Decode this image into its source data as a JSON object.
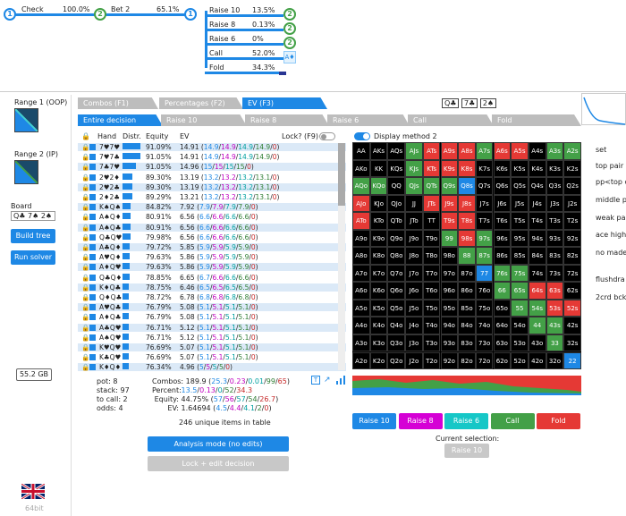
{
  "tree": {
    "check_label": "Check",
    "check_pct": "100.0%",
    "bet_label": "Bet 2",
    "bet_pct": "65.1%",
    "node1": "1",
    "node2": "2",
    "node3": "1",
    "actions": [
      {
        "label": "Raise 10",
        "pct": "13.5%",
        "node": "2"
      },
      {
        "label": "Raise 8",
        "pct": "0.13%",
        "node": "2"
      },
      {
        "label": "Raise 6",
        "pct": "0%",
        "node": "2"
      },
      {
        "label": "Call",
        "pct": "52.0%",
        "node": "A♦"
      },
      {
        "label": "Fold",
        "pct": "34.3%",
        "node": ""
      }
    ]
  },
  "left": {
    "range1_label": "Range 1 (OOP)",
    "range2_label": "Range 2 (IP)",
    "board_label": "Board",
    "board_value": "Q♣ 7♠ 2♠",
    "build_tree": "Build tree",
    "run_solver": "Run solver",
    "memory": "55.2 GB",
    "bits": "64bit"
  },
  "tabs": {
    "combos": "Combos (F1)",
    "percentages": "Percentages (F2)",
    "ev": "EV (F3)",
    "board_cards": [
      "Q♣",
      "7♣",
      "2♠"
    ],
    "sub": [
      "Entire decision",
      "Raise 10",
      "Raise 8",
      "Raise 6",
      "Call",
      "Fold"
    ]
  },
  "table": {
    "headers": {
      "hand": "Hand",
      "distr": "Distr.",
      "equity": "Equity",
      "ev": "EV",
      "lock": "Lock? (F9)"
    },
    "rows": [
      {
        "hand": "7♥7♥",
        "eq": "91.09%",
        "ev": "14.91",
        "parts": [
          "14.9",
          "14.9",
          "14.9",
          "14.9",
          "0"
        ],
        "d": 0.9,
        "alt": true,
        "c1": "#c62828",
        "c2": "#c62828"
      },
      {
        "hand": "7♥7♣",
        "eq": "91.05%",
        "ev": "14.91",
        "parts": [
          "14.9",
          "14.9",
          "14.9",
          "14.9",
          "0"
        ],
        "d": 0.9,
        "alt": false,
        "c1": "#c62828",
        "c2": "#2e7d32"
      },
      {
        "hand": "7♣7♥",
        "eq": "91.05%",
        "ev": "14.96",
        "parts": [
          "15",
          "15",
          "15",
          "15",
          "0"
        ],
        "d": 0.7,
        "alt": true,
        "c1": "#2e7d32",
        "c2": "#c62828"
      },
      {
        "hand": "2♥2♦",
        "eq": "89.30%",
        "ev": "13.19",
        "parts": [
          "13.2",
          "13.2",
          "13.2",
          "13.1",
          "0"
        ],
        "d": 0.5,
        "alt": false,
        "c1": "#c62828",
        "c2": "#1e88e5"
      },
      {
        "hand": "2♥2♣",
        "eq": "89.30%",
        "ev": "13.19",
        "parts": [
          "13.2",
          "13.2",
          "13.2",
          "13.1",
          "0"
        ],
        "d": 0.5,
        "alt": true,
        "c1": "#c62828",
        "c2": "#2e7d32"
      },
      {
        "hand": "2♦2♣",
        "eq": "89.29%",
        "ev": "13.21",
        "parts": [
          "13.2",
          "13.2",
          "13.2",
          "13.1",
          "0"
        ],
        "d": 0.5,
        "alt": false,
        "c1": "#1e88e5",
        "c2": "#2e7d32"
      },
      {
        "hand": "K♠Q♠",
        "eq": "84.82%",
        "ev": "7.92",
        "parts": [
          "7.9",
          "7.9",
          "7.9",
          "7.9",
          "0"
        ],
        "d": 0.4,
        "alt": true,
        "c1": "#222",
        "c2": "#222"
      },
      {
        "hand": "A♠Q♦",
        "eq": "80.91%",
        "ev": "6.56",
        "parts": [
          "6.6",
          "6.6",
          "6.6",
          "6.6",
          "0"
        ],
        "d": 0.4,
        "alt": false,
        "c1": "#222",
        "c2": "#1e88e5"
      },
      {
        "hand": "A♠Q♣",
        "eq": "80.91%",
        "ev": "6.56",
        "parts": [
          "6.6",
          "6.6",
          "6.6",
          "6.6",
          "0"
        ],
        "d": 0.4,
        "alt": true,
        "c1": "#222",
        "c2": "#2e7d32"
      },
      {
        "hand": "Q♣Q♥",
        "eq": "79.98%",
        "ev": "6.56",
        "parts": [
          "6.6",
          "6.6",
          "6.6",
          "6.6",
          "0"
        ],
        "d": 0.4,
        "alt": false,
        "c1": "#2e7d32",
        "c2": "#c62828"
      },
      {
        "hand": "A♣Q♦",
        "eq": "79.72%",
        "ev": "5.85",
        "parts": [
          "5.9",
          "5.9",
          "5.9",
          "5.9",
          "0"
        ],
        "d": 0.35,
        "alt": true,
        "c1": "#2e7d32",
        "c2": "#1e88e5"
      },
      {
        "hand": "A♥Q♦",
        "eq": "79.63%",
        "ev": "5.86",
        "parts": [
          "5.9",
          "5.9",
          "5.9",
          "5.9",
          "0"
        ],
        "d": 0.35,
        "alt": false,
        "c1": "#c62828",
        "c2": "#1e88e5"
      },
      {
        "hand": "A♦Q♥",
        "eq": "79.63%",
        "ev": "5.86",
        "parts": [
          "5.9",
          "5.9",
          "5.9",
          "5.9",
          "0"
        ],
        "d": 0.35,
        "alt": true,
        "c1": "#1e88e5",
        "c2": "#c62828"
      },
      {
        "hand": "Q♣Q♦",
        "eq": "78.85%",
        "ev": "6.65",
        "parts": [
          "6.7",
          "6.6",
          "6.6",
          "6.6",
          "0"
        ],
        "d": 0.35,
        "alt": false,
        "c1": "#2e7d32",
        "c2": "#1e88e5"
      },
      {
        "hand": "K♦Q♣",
        "eq": "78.75%",
        "ev": "6.46",
        "parts": [
          "6.5",
          "6.5",
          "6.5",
          "6.5",
          "0"
        ],
        "d": 0.3,
        "alt": true,
        "c1": "#1e88e5",
        "c2": "#2e7d32"
      },
      {
        "hand": "Q♦Q♣",
        "eq": "78.72%",
        "ev": "6.78",
        "parts": [
          "6.8",
          "6.8",
          "6.8",
          "6.8",
          "0"
        ],
        "d": 0.3,
        "alt": false,
        "c1": "#1e88e5",
        "c2": "#2e7d32"
      },
      {
        "hand": "A♥Q♣",
        "eq": "76.79%",
        "ev": "5.08",
        "parts": [
          "5.1",
          "5.1",
          "5.1",
          "5.1",
          "0"
        ],
        "d": 0.3,
        "alt": true,
        "c1": "#c62828",
        "c2": "#2e7d32"
      },
      {
        "hand": "A♦Q♣",
        "eq": "76.79%",
        "ev": "5.08",
        "parts": [
          "5.1",
          "5.1",
          "5.1",
          "5.1",
          "0"
        ],
        "d": 0.3,
        "alt": false,
        "c1": "#1e88e5",
        "c2": "#2e7d32"
      },
      {
        "hand": "A♣Q♥",
        "eq": "76.71%",
        "ev": "5.12",
        "parts": [
          "5.1",
          "5.1",
          "5.1",
          "5.1",
          "0"
        ],
        "d": 0.3,
        "alt": true,
        "c1": "#2e7d32",
        "c2": "#c62828"
      },
      {
        "hand": "A♠Q♥",
        "eq": "76.71%",
        "ev": "5.12",
        "parts": [
          "5.1",
          "5.1",
          "5.1",
          "5.1",
          "0"
        ],
        "d": 0.3,
        "alt": false,
        "c1": "#222",
        "c2": "#c62828"
      },
      {
        "hand": "K♥Q♥",
        "eq": "76.69%",
        "ev": "5.07",
        "parts": [
          "5.1",
          "5.1",
          "5.1",
          "5.1",
          "0"
        ],
        "d": 0.3,
        "alt": true,
        "c1": "#c62828",
        "c2": "#c62828"
      },
      {
        "hand": "K♣Q♥",
        "eq": "76.69%",
        "ev": "5.07",
        "parts": [
          "5.1",
          "5.1",
          "5.1",
          "5.1",
          "0"
        ],
        "d": 0.3,
        "alt": false,
        "c1": "#2e7d32",
        "c2": "#c62828"
      },
      {
        "hand": "K♦Q♦",
        "eq": "76.34%",
        "ev": "4.96",
        "parts": [
          "5",
          "5",
          "5",
          "5",
          "0"
        ],
        "d": 0.3,
        "alt": true,
        "c1": "#1e88e5",
        "c2": "#1e88e5"
      }
    ]
  },
  "summary": {
    "pot": "pot: 8",
    "stack": "stack: 97",
    "tocall": "to call: 2",
    "odds": "odds: 4",
    "combos_label": "Combos:",
    "combos_val": "189.9",
    "combos_parts": [
      "25.3",
      "0.23",
      "0.01",
      "99",
      "65"
    ],
    "percent_label": "Percent:",
    "percent_parts": [
      "13.5",
      "0.13",
      "0",
      "52",
      "34.3"
    ],
    "equity_label": "Equity:",
    "equity_val": "44.75%",
    "equity_parts": [
      "57",
      "56",
      "57",
      "54",
      "26.7"
    ],
    "ev_label": "EV:",
    "ev_val": "1.64694",
    "ev_parts": [
      "4.5",
      "4.4",
      "4.1",
      "2",
      "0"
    ],
    "unique": "246 unique items in table"
  },
  "buttons": {
    "analysis": "Analysis mode (no edits)",
    "lock": "Lock + edit decision",
    "display": "Display method 2",
    "current_sel": "Current selection:",
    "current_val": "Raise 10"
  },
  "legend": [
    {
      "label": "Raise 10",
      "color": "#1e88e5"
    },
    {
      "label": "Raise 8",
      "color": "#d500d5"
    },
    {
      "label": "Raise 6",
      "color": "#16c7c7"
    },
    {
      "label": "Call",
      "color": "#43a047"
    },
    {
      "label": "Fold",
      "color": "#e53935"
    }
  ],
  "right_list": [
    "set",
    "top pair",
    "pp<top c",
    "middle p",
    "weak pai",
    "ace high",
    "no made",
    "flushdra",
    "2crd bck"
  ],
  "grid": [
    [
      "AA",
      "AKs",
      "AQs",
      "AJs",
      "ATs",
      "A9s",
      "A8s",
      "A7s",
      "A6s",
      "A5s",
      "A4s",
      "A3s",
      "A2s"
    ],
    [
      "AKo",
      "KK",
      "KQs",
      "KJs",
      "KTs",
      "K9s",
      "K8s",
      "K7s",
      "K6s",
      "K5s",
      "K4s",
      "K3s",
      "K2s"
    ],
    [
      "AQo",
      "KQo",
      "QQ",
      "QJs",
      "QTs",
      "Q9s",
      "Q8s",
      "Q7s",
      "Q6s",
      "Q5s",
      "Q4s",
      "Q3s",
      "Q2s"
    ],
    [
      "AJo",
      "KJo",
      "QJo",
      "JJ",
      "JTs",
      "J9s",
      "J8s",
      "J7s",
      "J6s",
      "J5s",
      "J4s",
      "J3s",
      "J2s"
    ],
    [
      "ATo",
      "KTo",
      "QTo",
      "JTo",
      "TT",
      "T9s",
      "T8s",
      "T7s",
      "T6s",
      "T5s",
      "T4s",
      "T3s",
      "T2s"
    ],
    [
      "A9o",
      "K9o",
      "Q9o",
      "J9o",
      "T9o",
      "99",
      "98s",
      "97s",
      "96s",
      "95s",
      "94s",
      "93s",
      "92s"
    ],
    [
      "A8o",
      "K8o",
      "Q8o",
      "J8o",
      "T8o",
      "98o",
      "88",
      "87s",
      "86s",
      "85s",
      "84s",
      "83s",
      "82s"
    ],
    [
      "A7o",
      "K7o",
      "Q7o",
      "J7o",
      "T7o",
      "97o",
      "87o",
      "77",
      "76s",
      "75s",
      "74s",
      "73s",
      "72s"
    ],
    [
      "A6o",
      "K6o",
      "Q6o",
      "J6o",
      "T6o",
      "96o",
      "86o",
      "76o",
      "66",
      "65s",
      "64s",
      "63s",
      "62s"
    ],
    [
      "A5o",
      "K5o",
      "Q5o",
      "J5o",
      "T5o",
      "95o",
      "85o",
      "75o",
      "65o",
      "55",
      "54s",
      "53s",
      "52s"
    ],
    [
      "A4o",
      "K4o",
      "Q4o",
      "J4o",
      "T4o",
      "94o",
      "84o",
      "74o",
      "64o",
      "54o",
      "44",
      "43s",
      "42s"
    ],
    [
      "A3o",
      "K3o",
      "Q3o",
      "J3o",
      "T3o",
      "93o",
      "83o",
      "73o",
      "63o",
      "53o",
      "43o",
      "33",
      "32s"
    ],
    [
      "A2o",
      "K2o",
      "Q2o",
      "J2o",
      "T2o",
      "92o",
      "82o",
      "72o",
      "62o",
      "52o",
      "42o",
      "32o",
      "22"
    ]
  ],
  "colors": {
    "accent": "#1e88e5",
    "tabgray": "#9e9e9e",
    "rowalt": "#dbe9f7"
  }
}
